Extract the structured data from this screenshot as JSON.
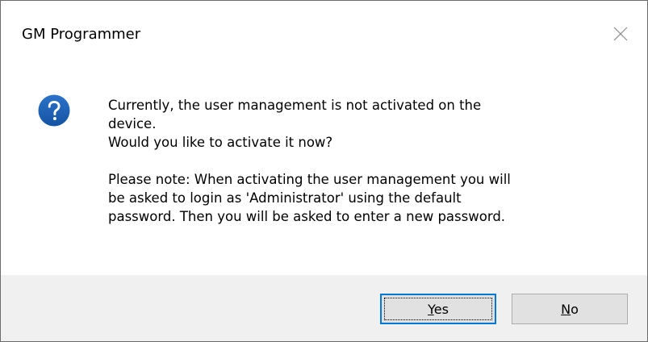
{
  "window": {
    "title": "GM Programmer",
    "close_icon": "close-icon"
  },
  "dialog": {
    "icon": "question-icon",
    "icon_color": "#1e5fb4",
    "message_lines": [
      "Currently, the user management is not activated on the",
      "device.",
      "Would you like to activate it now?",
      "",
      "Please note: When activating the user management you will",
      "be asked to login as 'Administrator' using the default",
      "password. Then you will be asked to enter a new password."
    ]
  },
  "buttons": {
    "yes": {
      "accel": "Y",
      "rest": "es",
      "default": true
    },
    "no": {
      "accel": "N",
      "rest": "o",
      "default": false
    }
  },
  "colors": {
    "focus_border": "#0078d7",
    "footer_bg": "#f0f0f0",
    "button_bg": "#e1e1e1"
  }
}
